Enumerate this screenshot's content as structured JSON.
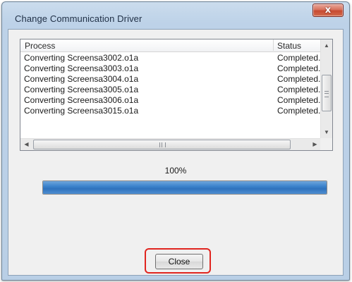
{
  "window": {
    "title": "Change Communication Driver"
  },
  "titlebar": {
    "close_glyph": "x",
    "close_icon": "close-icon"
  },
  "process_list": {
    "columns": [
      "Process",
      "Status"
    ],
    "rows": [
      {
        "process": "Converting Screensa3002.o1a",
        "status": "Completed."
      },
      {
        "process": "Converting Screensa3003.o1a",
        "status": "Completed."
      },
      {
        "process": "Converting Screensa3004.o1a",
        "status": "Completed."
      },
      {
        "process": "Converting Screensa3005.o1a",
        "status": "Completed."
      },
      {
        "process": "Converting Screensa3006.o1a",
        "status": "Completed."
      },
      {
        "process": "Converting Screensa3015.o1a",
        "status": "Completed."
      }
    ]
  },
  "progress": {
    "percent_text": "100%",
    "value": 1.0,
    "fill_color": "#3c83cc"
  },
  "buttons": {
    "close_label": "Close",
    "highlight_color": "#e0251f"
  }
}
